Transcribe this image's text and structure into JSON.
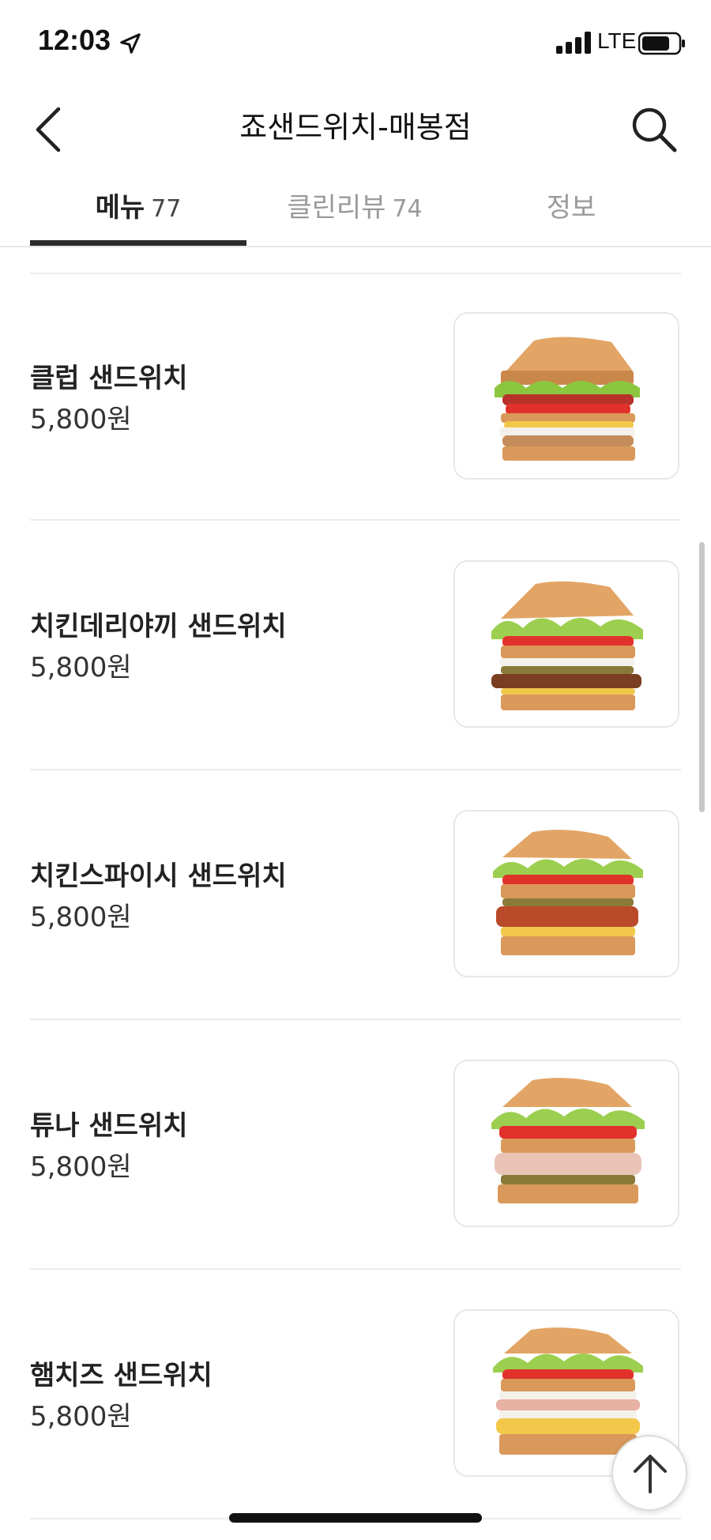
{
  "status_bar": {
    "time": "12:03",
    "network": "LTE",
    "icons": [
      "location-arrow-icon",
      "signal-bars-icon",
      "battery-icon"
    ]
  },
  "header": {
    "title": "죠샌드위치-매봉점",
    "back_icon": "chevron-left-icon",
    "search_icon": "search-icon"
  },
  "tabs": [
    {
      "label": "메뉴",
      "count": "77",
      "active": true
    },
    {
      "label": "클린리뷰",
      "count": "74",
      "active": false
    },
    {
      "label": "정보",
      "count": "",
      "active": false
    }
  ],
  "menu_items": [
    {
      "name": "클럽 샌드위치",
      "price": "5,800원",
      "image": "club-sandwich-image"
    },
    {
      "name": "치킨데리야끼 샌드위치",
      "price": "5,800원",
      "image": "chicken-teriyaki-sandwich-image"
    },
    {
      "name": "치킨스파이시 샌드위치",
      "price": "5,800원",
      "image": "chicken-spicy-sandwich-image"
    },
    {
      "name": "튜나 샌드위치",
      "price": "5,800원",
      "image": "tuna-sandwich-image"
    },
    {
      "name": "햄치즈 샌드위치",
      "price": "5,800원",
      "image": "ham-cheese-sandwich-image"
    }
  ],
  "scroll_top_icon": "arrow-up-icon",
  "colors": {
    "text_primary": "#222222",
    "text_muted": "#9a9a9a",
    "tab_indicator": "#2b2b2b",
    "divider": "#ececec",
    "bread": "#d9995a",
    "lettuce": "#8cc63f",
    "tomato": "#e0322b"
  }
}
